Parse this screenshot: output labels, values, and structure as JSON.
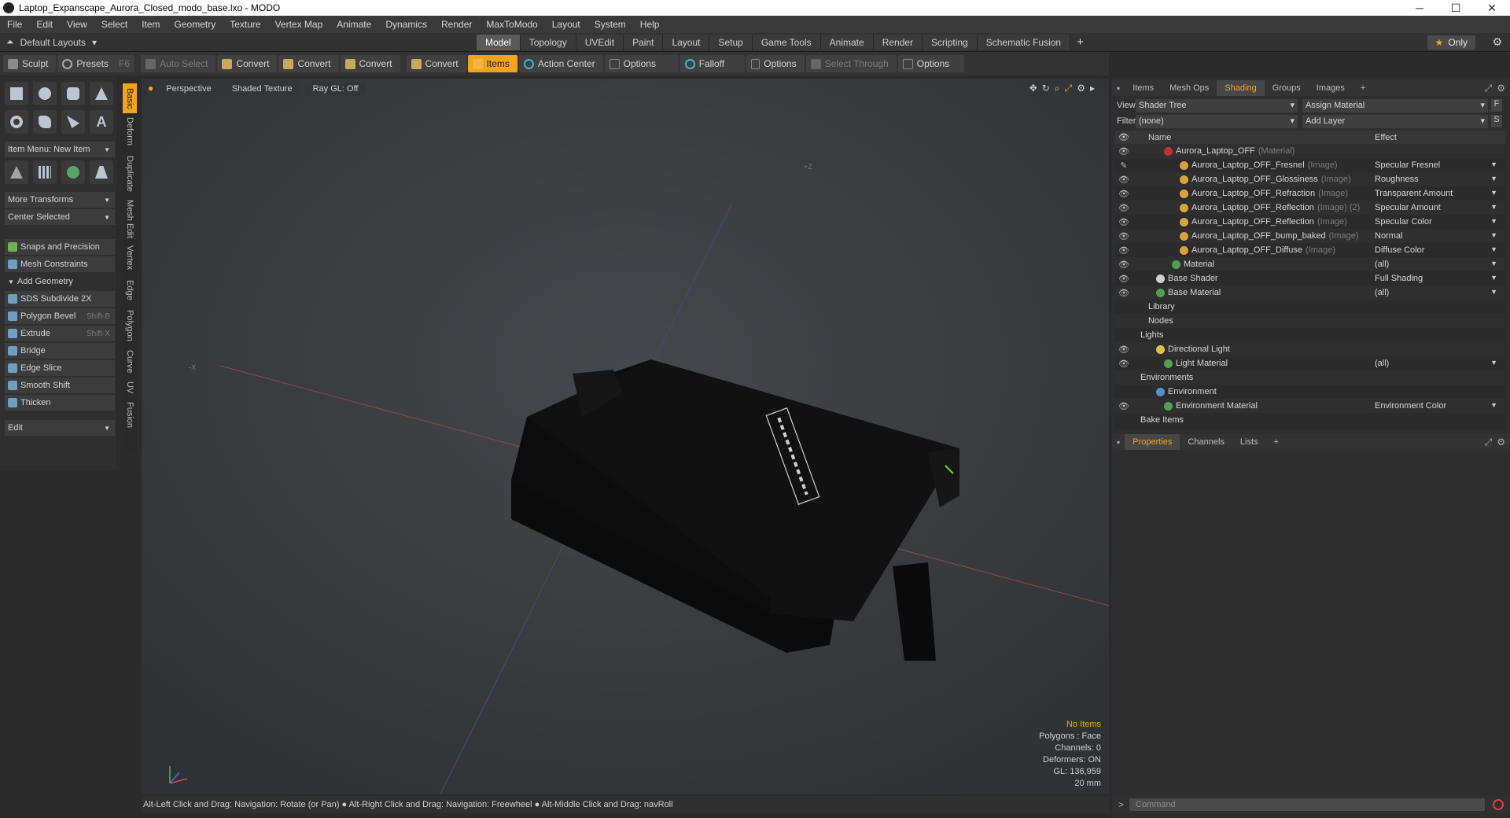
{
  "window": {
    "title": "Laptop_Expanscape_Aurora_Closed_modo_base.lxo - MODO",
    "controls": [
      "─",
      "☐",
      "✕"
    ]
  },
  "menu": [
    "File",
    "Edit",
    "View",
    "Select",
    "Item",
    "Geometry",
    "Texture",
    "Vertex Map",
    "Animate",
    "Dynamics",
    "Render",
    "MaxToModo",
    "Layout",
    "System",
    "Help"
  ],
  "layout_bar": {
    "layout_select": "Default Layouts",
    "tabs": [
      "Model",
      "Topology",
      "UVEdit",
      "Paint",
      "Layout",
      "Setup",
      "Game Tools",
      "Animate",
      "Render",
      "Scripting",
      "Schematic Fusion"
    ],
    "active_tab": "Model",
    "only_label": "Only"
  },
  "toolbar": {
    "sculpt": "Sculpt",
    "presets": "Presets",
    "presets_key": "F6",
    "auto_select": "Auto Select",
    "convert1": "Convert",
    "convert2": "Convert",
    "convert3": "Convert",
    "convert4": "Convert",
    "items": "Items",
    "action_center": "Action Center",
    "options1": "Options",
    "falloff": "Falloff",
    "options2": "Options",
    "select_through": "Select Through",
    "options3": "Options"
  },
  "left_panel": {
    "item_menu": "Item Menu: New Item",
    "more_transforms": "More Transforms",
    "center_selected": "Center Selected",
    "snaps": "Snaps and Precision",
    "mesh_constraints": "Mesh Constraints",
    "add_geometry": "Add Geometry",
    "tools": [
      {
        "label": "SDS Subdivide 2X",
        "key": ""
      },
      {
        "label": "Polygon Bevel",
        "key": "Shift-B"
      },
      {
        "label": "Extrude",
        "key": "Shift-X"
      },
      {
        "label": "Bridge",
        "key": ""
      },
      {
        "label": "Edge Slice",
        "key": ""
      },
      {
        "label": "Smooth Shift",
        "key": ""
      },
      {
        "label": "Thicken",
        "key": ""
      }
    ],
    "edit": "Edit",
    "vertical_tabs": [
      "Basic",
      "Deform",
      "Duplicate",
      "Mesh Edit",
      "Vertex",
      "Edge",
      "Polygon",
      "Curve",
      "UV",
      "Fusion"
    ]
  },
  "viewport": {
    "view_mode": "Perspective",
    "shading": "Shaded Texture",
    "raygl": "Ray GL: Off",
    "info": {
      "no_items": "No Items",
      "polygons": "Polygons : Face",
      "channels": "Channels: 0",
      "deformers": "Deformers: ON",
      "gl": "GL: 136,959",
      "scale": "20 mm"
    }
  },
  "status_bar": "Alt-Left Click and Drag: Navigation: Rotate (or Pan) ● Alt-Right Click and Drag: Navigation: Freewheel ● Alt-Middle Click and Drag: navRoll",
  "right_panel": {
    "tabs": [
      "Items",
      "Mesh Ops",
      "Shading",
      "Groups",
      "Images"
    ],
    "active_tab": "Shading",
    "view_label": "View",
    "view_value": "Shader Tree",
    "assign_material": "Assign Material",
    "filter_label": "Filter",
    "filter_value": "(none)",
    "add_layer": "Add Layer",
    "col_name": "Name",
    "col_effect": "Effect",
    "tree": [
      {
        "name": "Aurora_Laptop_OFF",
        "type": "(Material)",
        "effect": "",
        "indent": 4,
        "dot": "#c03030",
        "eye": "👁"
      },
      {
        "name": "Aurora_Laptop_OFF_Fresnel",
        "type": "(Image)",
        "effect": "Specular Fresnel",
        "indent": 6,
        "dot": "#d9a23a",
        "eye": "✎"
      },
      {
        "name": "Aurora_Laptop_OFF_Glossiness",
        "type": "(Image)",
        "effect": "Roughness",
        "indent": 6,
        "dot": "#d9a23a",
        "eye": "👁"
      },
      {
        "name": "Aurora_Laptop_OFF_Refraction",
        "type": "(Image)",
        "effect": "Transparent Amount",
        "indent": 6,
        "dot": "#d9a23a",
        "eye": "👁"
      },
      {
        "name": "Aurora_Laptop_OFF_Reflection",
        "type": "(Image) (2)",
        "effect": "Specular Amount",
        "indent": 6,
        "dot": "#d9a23a",
        "eye": "👁"
      },
      {
        "name": "Aurora_Laptop_OFF_Reflection",
        "type": "(Image)",
        "effect": "Specular Color",
        "indent": 6,
        "dot": "#d9a23a",
        "eye": "👁"
      },
      {
        "name": "Aurora_Laptop_OFF_bump_baked",
        "type": "(Image)",
        "effect": "Normal",
        "indent": 6,
        "dot": "#d9a23a",
        "eye": "👁"
      },
      {
        "name": "Aurora_Laptop_OFF_Diffuse",
        "type": "(Image)",
        "effect": "Diffuse Color",
        "indent": 6,
        "dot": "#d9a23a",
        "eye": "👁"
      },
      {
        "name": "Material",
        "type": "",
        "effect": "(all)",
        "indent": 5,
        "dot": "#4fa04f",
        "eye": "👁"
      },
      {
        "name": "Base Shader",
        "type": "",
        "effect": "Full Shading",
        "indent": 3,
        "dot": "#cfcfcf",
        "eye": "👁"
      },
      {
        "name": "Base Material",
        "type": "",
        "effect": "(all)",
        "indent": 3,
        "dot": "#4fa04f",
        "eye": "👁"
      },
      {
        "name": "Library",
        "type": "",
        "effect": "",
        "indent": 2,
        "dot": "",
        "eye": ""
      },
      {
        "name": "Nodes",
        "type": "",
        "effect": "",
        "indent": 2,
        "dot": "",
        "eye": ""
      },
      {
        "name": "Lights",
        "type": "",
        "effect": "",
        "indent": 1,
        "dot": "",
        "eye": ""
      },
      {
        "name": "Directional Light",
        "type": "",
        "effect": "",
        "indent": 3,
        "dot": "#d9c34a",
        "eye": "👁"
      },
      {
        "name": "Light Material",
        "type": "",
        "effect": "(all)",
        "indent": 4,
        "dot": "#4fa04f",
        "eye": "👁"
      },
      {
        "name": "Environments",
        "type": "",
        "effect": "",
        "indent": 1,
        "dot": "",
        "eye": ""
      },
      {
        "name": "Environment",
        "type": "",
        "effect": "",
        "indent": 3,
        "dot": "#5a8ad0",
        "eye": ""
      },
      {
        "name": "Environment Material",
        "type": "",
        "effect": "Environment Color",
        "indent": 4,
        "dot": "#4fa04f",
        "eye": "👁"
      },
      {
        "name": "Bake Items",
        "type": "",
        "effect": "",
        "indent": 1,
        "dot": "",
        "eye": ""
      }
    ],
    "props_tabs": [
      "Properties",
      "Channels",
      "Lists"
    ],
    "props_active": "Properties"
  },
  "command_placeholder": "Command"
}
